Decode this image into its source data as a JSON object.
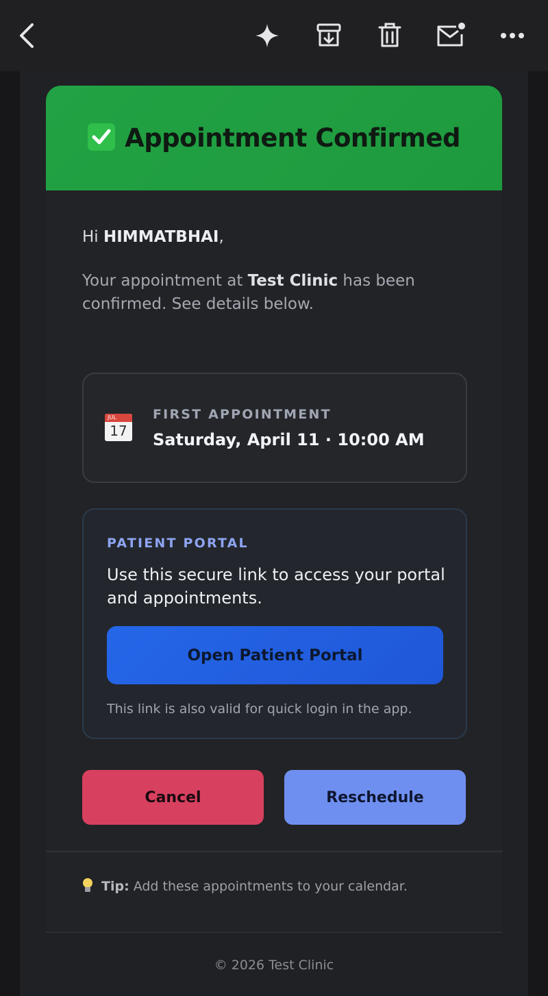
{
  "toolbar": {
    "icons": [
      "back-icon",
      "sparkle-icon",
      "archive-icon",
      "trash-icon",
      "mark-unread-icon",
      "more-icon"
    ]
  },
  "email": {
    "header_title": "Appointment Confirmed",
    "greeting_prefix": "Hi ",
    "patient_name": "HIMMATBHAI",
    "greeting_suffix": ",",
    "intro_before": "Your appointment at ",
    "clinic_name": "Test Clinic",
    "intro_after": " has been confirmed. See details below.",
    "appointment": {
      "label": "FIRST APPOINTMENT",
      "datetime": "Saturday, April 11 · 10:00 AM",
      "calendar_month": "JUL",
      "calendar_day": "17"
    },
    "portal": {
      "label": "PATIENT PORTAL",
      "description": "Use this secure link to access your portal and appointments.",
      "button_label": "Open Patient Portal",
      "note": "This link is also valid for quick login in the app."
    },
    "actions": {
      "cancel_label": "Cancel",
      "reschedule_label": "Reschedule"
    },
    "tip": {
      "label": "Tip:",
      "text": " Add these appointments to your calendar."
    },
    "footer": "© 2026 Test Clinic"
  },
  "colors": {
    "header_green": "#22a244",
    "portal_blue": "#2566e8",
    "cancel_red": "#d8405f",
    "reschedule_blue": "#6f8ff0",
    "portal_label": "#8ea4f2"
  }
}
